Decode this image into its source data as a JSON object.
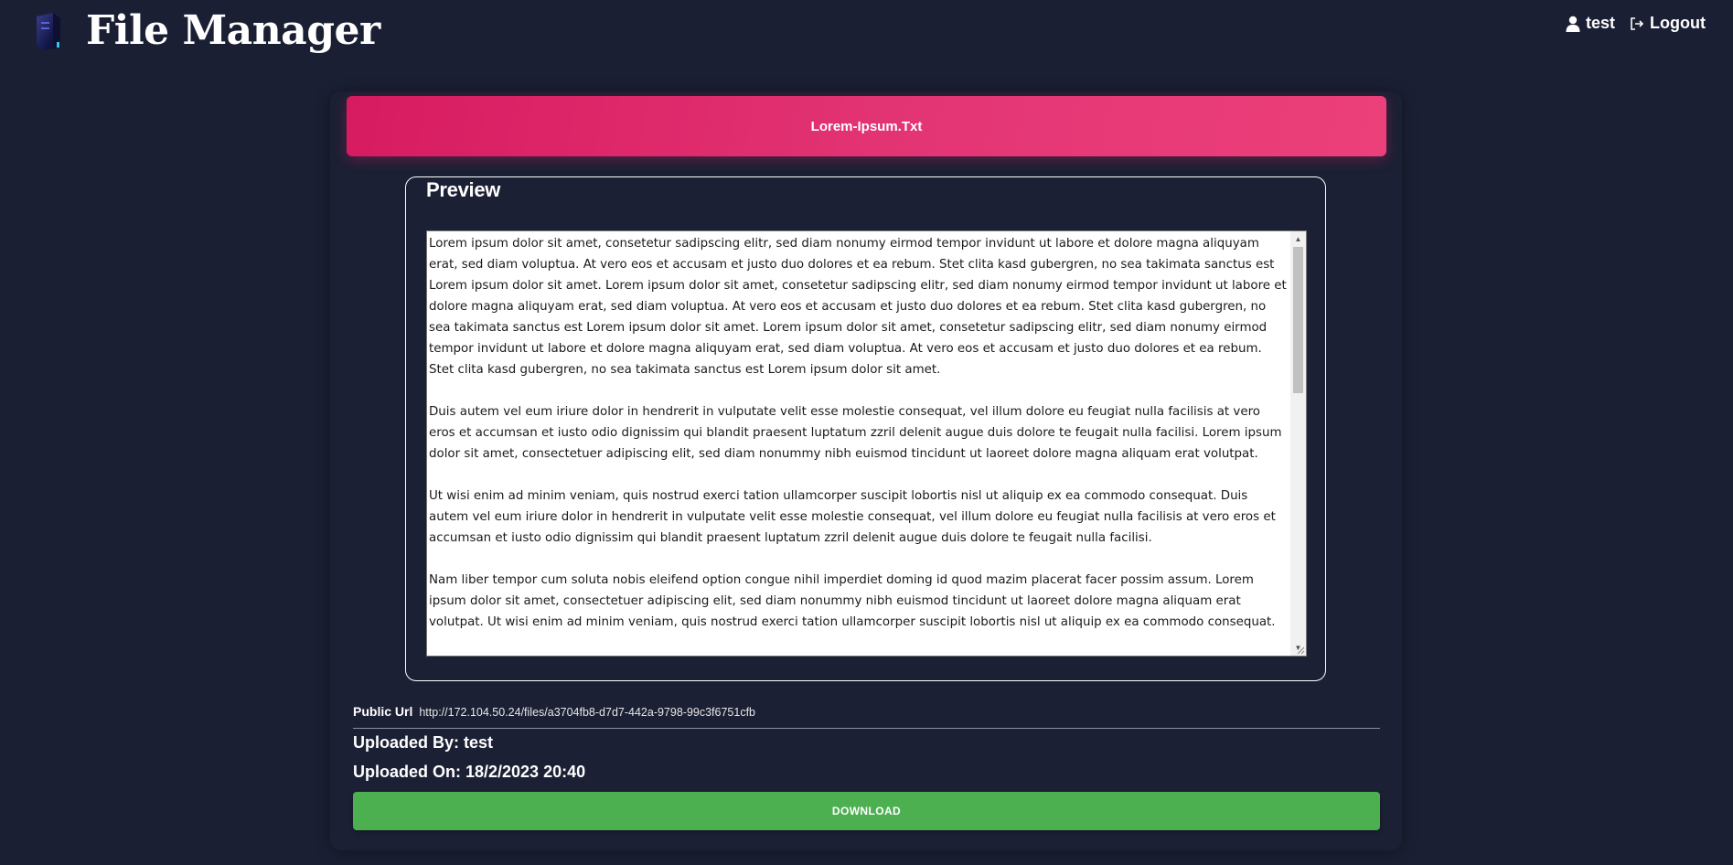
{
  "app": {
    "title": "File Manager",
    "logo_icon": "server-icon"
  },
  "user_nav": {
    "username": "test",
    "user_icon": "user-icon",
    "logout_label": "Logout",
    "logout_icon": "sign-out-icon"
  },
  "file": {
    "name": "Lorem-Ipsum.Txt",
    "preview_legend": "Preview",
    "preview_content": "Lorem ipsum dolor sit amet, consetetur sadipscing elitr, sed diam nonumy eirmod tempor invidunt ut labore et dolore magna aliquyam erat, sed diam voluptua. At vero eos et accusam et justo duo dolores et ea rebum. Stet clita kasd gubergren, no sea takimata sanctus est Lorem ipsum dolor sit amet. Lorem ipsum dolor sit amet, consetetur sadipscing elitr, sed diam nonumy eirmod tempor invidunt ut labore et dolore magna aliquyam erat, sed diam voluptua. At vero eos et accusam et justo duo dolores et ea rebum. Stet clita kasd gubergren, no sea takimata sanctus est Lorem ipsum dolor sit amet. Lorem ipsum dolor sit amet, consetetur sadipscing elitr, sed diam nonumy eirmod tempor invidunt ut labore et dolore magna aliquyam erat, sed diam voluptua. At vero eos et accusam et justo duo dolores et ea rebum. Stet clita kasd gubergren, no sea takimata sanctus est Lorem ipsum dolor sit amet.\n\nDuis autem vel eum iriure dolor in hendrerit in vulputate velit esse molestie consequat, vel illum dolore eu feugiat nulla facilisis at vero eros et accumsan et iusto odio dignissim qui blandit praesent luptatum zzril delenit augue duis dolore te feugait nulla facilisi. Lorem ipsum dolor sit amet, consectetuer adipiscing elit, sed diam nonummy nibh euismod tincidunt ut laoreet dolore magna aliquam erat volutpat.\n\nUt wisi enim ad minim veniam, quis nostrud exerci tation ullamcorper suscipit lobortis nisl ut aliquip ex ea commodo consequat. Duis autem vel eum iriure dolor in hendrerit in vulputate velit esse molestie consequat, vel illum dolore eu feugiat nulla facilisis at vero eros et accumsan et iusto odio dignissim qui blandit praesent luptatum zzril delenit augue duis dolore te feugait nulla facilisi.\n\nNam liber tempor cum soluta nobis eleifend option congue nihil imperdiet doming id quod mazim placerat facer possim assum. Lorem ipsum dolor sit amet, consectetuer adipiscing elit, sed diam nonummy nibh euismod tincidunt ut laoreet dolore magna aliquam erat volutpat. Ut wisi enim ad minim veniam, quis nostrud exerci tation ullamcorper suscipit lobortis nisl ut aliquip ex ea commodo consequat.",
    "public_url_label": "Public Url",
    "public_url": "http://172.104.50.24/files/a3704fb8-d7d7-442a-9798-99c3f6751cfb",
    "uploaded_by": "Uploaded By: test",
    "uploaded_on": "Uploaded On: 18/2/2023 20:40",
    "download_label": "DOWNLOAD"
  },
  "colors": {
    "background": "#1a1f33",
    "header_gradient_start": "#d81b60",
    "header_gradient_end": "#ec407a",
    "download_button": "#4caf50"
  }
}
